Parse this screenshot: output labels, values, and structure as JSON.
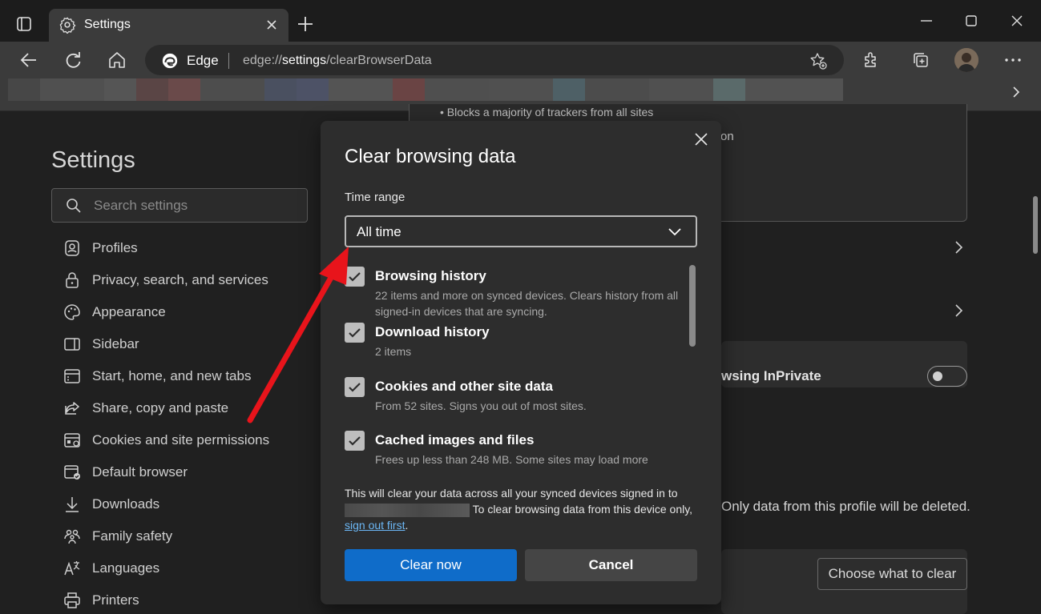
{
  "window": {
    "tab_title": "Settings"
  },
  "toolbar": {
    "site_name": "Edge",
    "url_prefix": "edge://",
    "url_host": "settings",
    "url_path": "/clearBrowserData"
  },
  "sidebar": {
    "title": "Settings",
    "search_placeholder": "Search settings",
    "items": [
      {
        "label": "Profiles",
        "icon": "profile-icon"
      },
      {
        "label": "Privacy, search, and services",
        "icon": "lock-icon"
      },
      {
        "label": "Appearance",
        "icon": "palette-icon"
      },
      {
        "label": "Sidebar",
        "icon": "sidebar-icon"
      },
      {
        "label": "Start, home, and new tabs",
        "icon": "home-tabs-icon"
      },
      {
        "label": "Share, copy and paste",
        "icon": "share-icon"
      },
      {
        "label": "Cookies and site permissions",
        "icon": "cookies-icon"
      },
      {
        "label": "Default browser",
        "icon": "default-browser-icon"
      },
      {
        "label": "Downloads",
        "icon": "download-icon"
      },
      {
        "label": "Family safety",
        "icon": "family-icon"
      },
      {
        "label": "Languages",
        "icon": "languages-icon"
      },
      {
        "label": "Printers",
        "icon": "printer-icon"
      }
    ]
  },
  "background": {
    "tracker_text": "Blocks a majority of trackers from all sites",
    "partial_on": "on",
    "inprivate_text": "wsing InPrivate",
    "profile_note": "Only data from this profile will be deleted.",
    "choose_button": "Choose what to clear"
  },
  "dialog": {
    "title": "Clear browsing data",
    "time_range_label": "Time range",
    "time_range_value": "All time",
    "items": [
      {
        "title": "Browsing history",
        "desc": "22 items and more on synced devices. Clears history from all signed-in devices that are syncing.",
        "checked": true
      },
      {
        "title": "Download history",
        "desc": "2 items",
        "checked": true
      },
      {
        "title": "Cookies and other site data",
        "desc": "From 52 sites. Signs you out of most sites.",
        "checked": true
      },
      {
        "title": "Cached images and files",
        "desc": "Frees up less than 248 MB. Some sites may load more",
        "checked": true
      }
    ],
    "note_part1": "This will clear your data across all your synced devices signed in to",
    "note_part2": "To clear browsing data from this device only,",
    "note_link": "sign out first",
    "note_end": ".",
    "clear_button": "Clear now",
    "cancel_button": "Cancel"
  },
  "colors": {
    "accent": "#0f6cc9",
    "link": "#6cb8f6",
    "annotation_arrow": "#e8141b"
  }
}
